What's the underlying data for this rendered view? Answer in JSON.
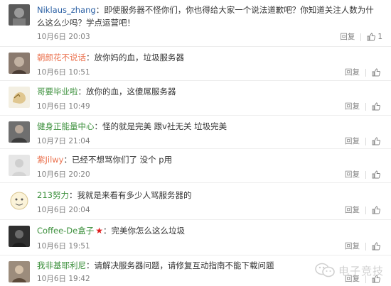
{
  "labels": {
    "reply": "回复",
    "separator": "："
  },
  "comments": [
    {
      "user": "Niklaus_zhang",
      "text": "即使服务器不怪你们，你也得给大家一个说法道歉吧？你知道关注人数为什么这么少吗？学点运营吧！",
      "date": "10月6日 20:03",
      "likes": "1"
    },
    {
      "user": "朝颜花不说话",
      "text": "放你妈的血，垃圾服务器",
      "date": "10月6日 10:51",
      "likes": ""
    },
    {
      "user": "哥要毕业啦",
      "text": "放你的血，这傻屌服务器",
      "date": "10月6日 10:49",
      "likes": ""
    },
    {
      "user": "健身正能量中心",
      "text": "怪的就是完美 跟v社无关 垃圾完美",
      "date": "10月7日 21:04",
      "likes": ""
    },
    {
      "user": "紫Jilwy",
      "text": "已经不想骂你们了 没个 p用",
      "date": "10月6日 20:20",
      "likes": ""
    },
    {
      "user": "213努力",
      "text": "我就是来看有多少人骂服务器的",
      "date": "10月6日 20:04",
      "likes": ""
    },
    {
      "user": "Coffee-De盒子",
      "text": "完美你怎么这么垃圾",
      "date": "10月6日 19:51",
      "likes": ""
    },
    {
      "user": "我非基耶利尼",
      "text": "请解决服务器问题，请修复互动指南不能下载问题",
      "date": "10月6日 19:42",
      "likes": ""
    }
  ],
  "watermark": {
    "text": "电子竞技"
  },
  "colors": {
    "username": "#eb7350",
    "meta": "#808080",
    "divider": "#ededed",
    "star": "#e02020"
  },
  "icons": {
    "like": "thumbs-up-icon",
    "badge": "red-star-icon",
    "watermark": "wechat-logo-icon"
  }
}
